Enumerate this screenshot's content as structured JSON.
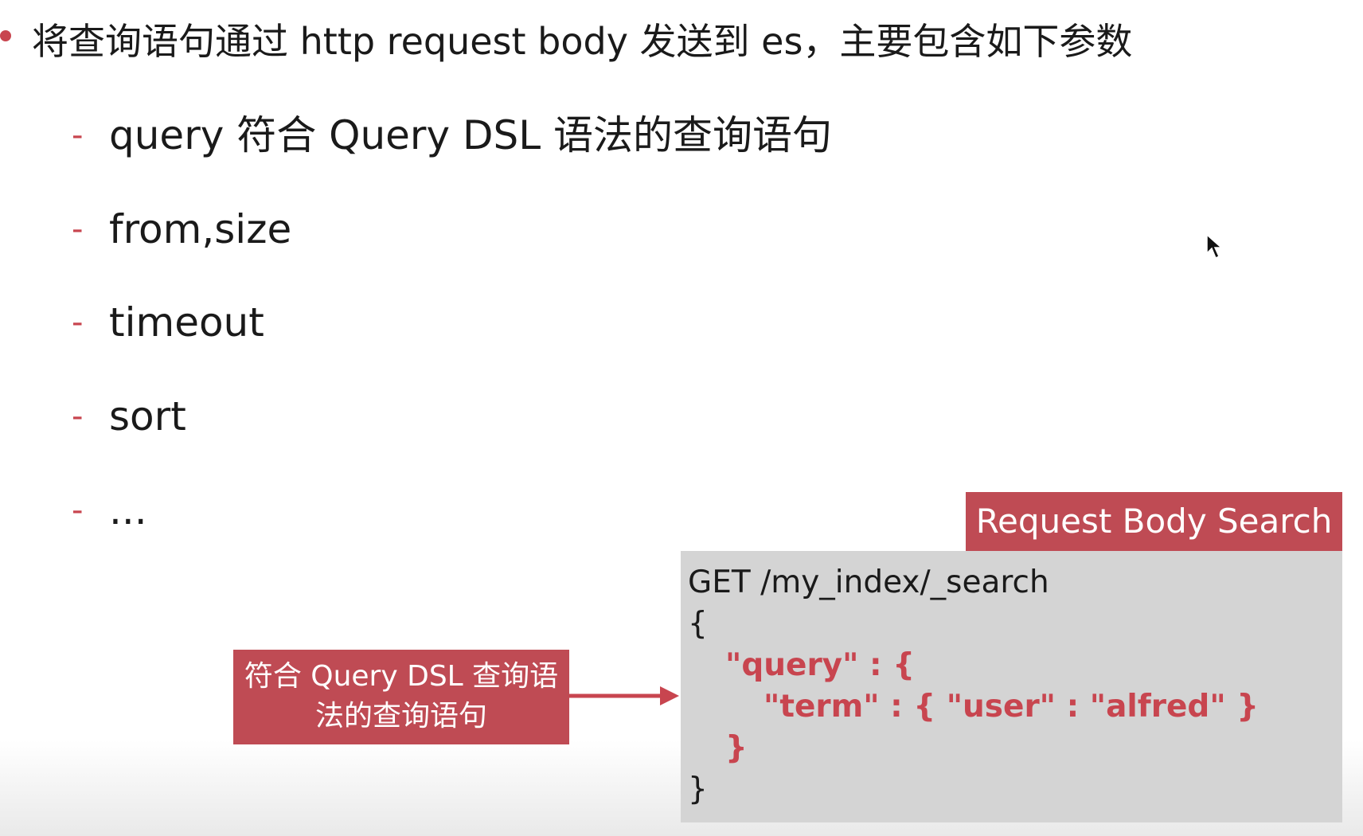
{
  "main_point": "将查询语句通过 http request body 发送到 es，主要包含如下参数",
  "sub_items": [
    {
      "dash": "-",
      "text": "query 符合 Query DSL 语法的查询语句"
    },
    {
      "dash": "-",
      "text": "from,size"
    },
    {
      "dash": "-",
      "text": "timeout"
    },
    {
      "dash": "-",
      "text": "sort"
    },
    {
      "dash": "-",
      "text": "..."
    }
  ],
  "example": {
    "header": "Request Body Search",
    "code": {
      "line1": "GET /my_index/_search",
      "open_brace": "{",
      "query_key": "\"query\"",
      "query_sep": " : {",
      "term_key": "\"term\"",
      "term_sep": " : { ",
      "user_key": "\"user\"",
      "user_sep": " : ",
      "user_value": "\"alfred\"",
      "term_close": " }",
      "query_close": "}",
      "close_brace": "}"
    }
  },
  "callout": {
    "line1": "符合 Query DSL 查询语",
    "line2": "法的查询语句"
  },
  "colors": {
    "accent": "#c8454f",
    "box_fill": "#bf4b54",
    "code_bg": "#d4d4d4"
  }
}
